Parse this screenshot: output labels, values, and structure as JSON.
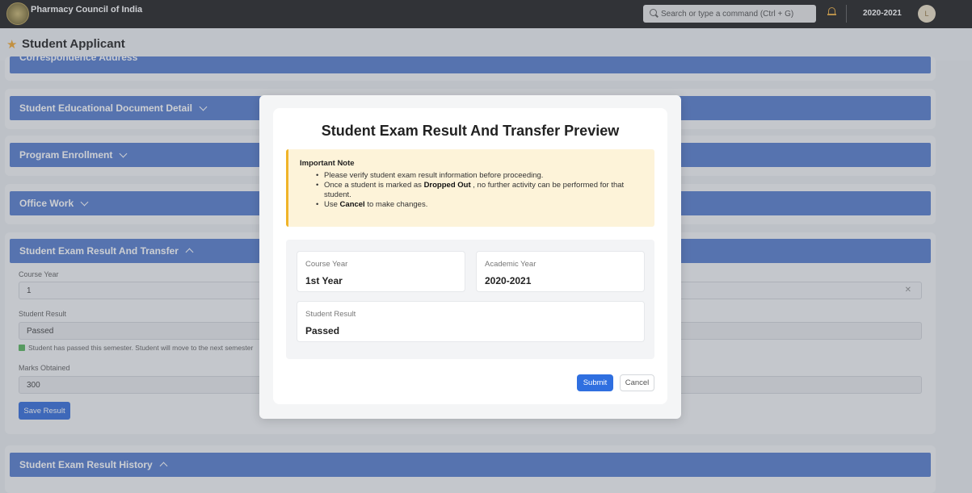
{
  "topbar": {
    "app_title": "Pharmacy Council of India",
    "search_placeholder": "Search or type a command (Ctrl + G)",
    "year": "2020-2021",
    "avatar_initial": "L"
  },
  "page": {
    "title": "Student Applicant"
  },
  "sections": {
    "correspondence": "Correspondence Address",
    "educational_docs": "Student Educational Document Detail",
    "program_enrollment": "Program Enrollment",
    "office_work": "Office Work",
    "exam_result": "Student Exam Result And Transfer",
    "exam_history": "Student Exam Result History"
  },
  "form": {
    "course_year_label": "Course Year",
    "course_year_value": "1",
    "student_result_label": "Student Result",
    "student_result_value": "Passed",
    "passed_note": "Student has passed this semester. Student will move to the next semester",
    "marks_label": "Marks Obtained",
    "marks_value": "300",
    "save_label": "Save Result"
  },
  "modal": {
    "title": "Student Exam Result And Transfer Preview",
    "note_title": "Important Note",
    "note_1": "Please verify student exam result information before proceeding.",
    "note_2_a": "Once a student is marked as ",
    "note_2_b": "Dropped Out",
    "note_2_c": " , no further activity can be performed for that student.",
    "note_3_a": "Use ",
    "note_3_b": "Cancel",
    "note_3_c": " to make changes.",
    "course_year_label": "Course Year",
    "course_year_value": "1st Year",
    "academic_year_label": "Academic Year",
    "academic_year_value": "2020-2021",
    "student_result_label": "Student Result",
    "student_result_value": "Passed",
    "submit_label": "Submit",
    "cancel_label": "Cancel"
  },
  "colors": {
    "section_bar": "#4a74c9",
    "primary_button": "#2f6fe0",
    "note_bg": "#fdf3d9",
    "note_border": "#f0b429"
  }
}
